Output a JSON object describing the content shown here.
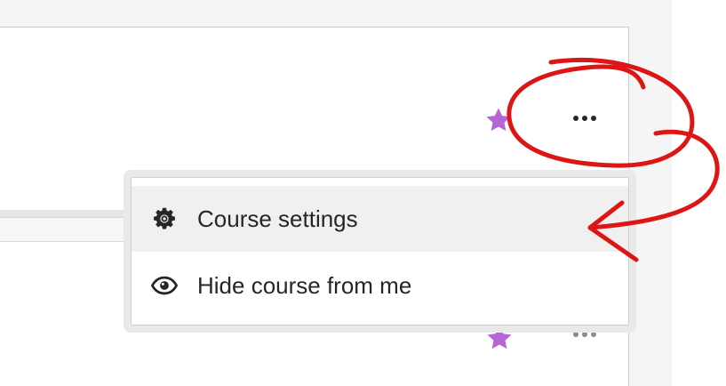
{
  "colors": {
    "star": "#b565d6",
    "annotation": "#dd1515",
    "menu_text": "#262626",
    "highlight": "#f0f0f0"
  },
  "cards": [
    {
      "star_icon": "star-icon",
      "more_icon": "more-horizontal-icon"
    },
    {
      "star_icon": "star-icon",
      "more_icon": "more-horizontal-icon"
    }
  ],
  "menu": {
    "items": [
      {
        "label": "Course settings",
        "icon": "gear-icon",
        "highlighted": true
      },
      {
        "label": "Hide course from me",
        "icon": "eye-icon",
        "highlighted": false
      }
    ]
  }
}
